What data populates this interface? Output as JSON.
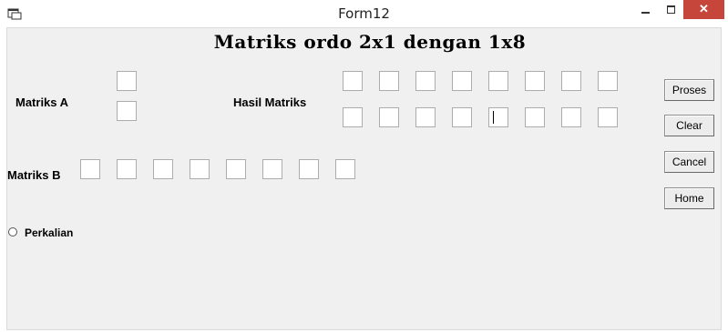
{
  "window": {
    "title": "Form12",
    "minimize_icon": "minimize-icon",
    "maximize_icon": "maximize-icon",
    "close_icon": "close-icon",
    "close_glyph": "✕",
    "close_color": "#c7463c"
  },
  "form": {
    "heading": "Matriks ordo 2x1 dengan 1x8",
    "label_matriks_a": "Matriks A",
    "label_hasil": "Hasil Matriks",
    "label_matriks_b": "Matriks B",
    "matriks_a_values": [
      "",
      ""
    ],
    "matriks_b_values": [
      "",
      "",
      "",
      "",
      "",
      "",
      "",
      ""
    ],
    "hasil_row1_values": [
      "",
      "",
      "",
      "",
      "",
      "",
      "",
      ""
    ],
    "hasil_row2_values": [
      "",
      "",
      "",
      "",
      "",
      "",
      "",
      ""
    ],
    "buttons": {
      "proses": "Proses",
      "clear": "Clear",
      "cancel": "Cancel",
      "home": "Home"
    },
    "radio_label": "Perkalian",
    "radio_checked": false
  }
}
